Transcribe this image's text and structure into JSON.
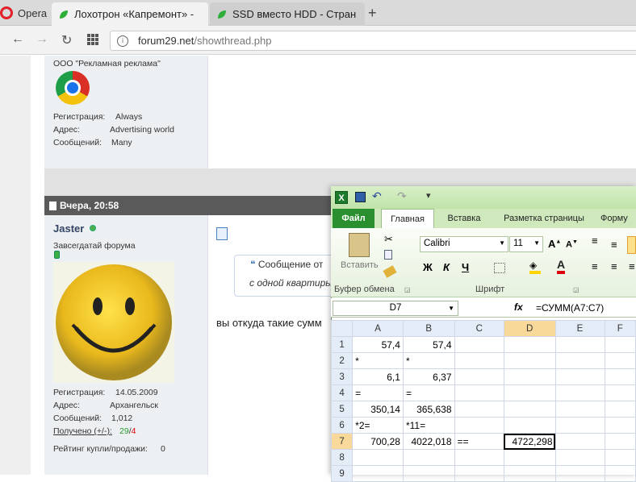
{
  "browser": {
    "brand": "Opera",
    "tabs": [
      {
        "title": "Лохотрон «Капремонт» -"
      },
      {
        "title": "SSD вместо HDD - Стран"
      }
    ],
    "url": {
      "host": "forum29.net",
      "path": "/showthread.php"
    }
  },
  "post1": {
    "company": "ООО \"Рекламная реклама\"",
    "reg_label": "Регистрация:",
    "reg_value": "Always",
    "addr_label": "Адрес:",
    "addr_value": "Advertising world",
    "msg_label": "Сообщений:",
    "msg_value": "Many"
  },
  "post2": {
    "header": "Вчера, 20:58",
    "username": "Jaster",
    "rank": "Завсегдатай форума",
    "reg_label": "Регистрация:",
    "reg_value": "14.05.2009",
    "addr_label": "Адрес:",
    "addr_value": "Архангельск",
    "msg_label": "Сообщений:",
    "msg_value": "1,012",
    "received_label": "Получено (+/-):",
    "received_plus": "29",
    "received_sep": "/",
    "received_minus": "4",
    "rating_label": "Рейтинг купли/продажи:",
    "rating_value": "0",
    "quote_title": "Сообщение от",
    "quote_text": "с одной квартиры",
    "body_text": "вы откуда такие сумм"
  },
  "excel": {
    "tabs": {
      "file": "Файл",
      "home": "Главная",
      "insert": "Вставка",
      "layout": "Разметка страницы",
      "formulas": "Форму"
    },
    "paste": "Вставить",
    "font": "Calibri",
    "size": "11",
    "groups": {
      "clipboard": "Буфер обмена",
      "font": "Шрифт"
    },
    "bold": "Ж",
    "italic": "К",
    "underline": "Ч",
    "namebox": "D7",
    "fx": "fx",
    "formula": "=СУММ(A7:C7)",
    "columns": [
      "A",
      "B",
      "C",
      "D",
      "E",
      "F"
    ],
    "rows": [
      {
        "n": "1",
        "A": "57,4",
        "B": "57,4",
        "C": "",
        "D": ""
      },
      {
        "n": "2",
        "A": "*",
        "B": "*",
        "C": "",
        "D": ""
      },
      {
        "n": "3",
        "A": "6,1",
        "B": "6,37",
        "C": "",
        "D": ""
      },
      {
        "n": "4",
        "A": "=",
        "B": "=",
        "C": "",
        "D": ""
      },
      {
        "n": "5",
        "A": "350,14",
        "B": "365,638",
        "C": "",
        "D": ""
      },
      {
        "n": "6",
        "A": "*2=",
        "B": "*11=",
        "C": "",
        "D": ""
      },
      {
        "n": "7",
        "A": "700,28",
        "B": "4022,018",
        "C": "==",
        "D": "4722,298"
      },
      {
        "n": "8",
        "A": "",
        "B": "",
        "C": "",
        "D": ""
      },
      {
        "n": "9",
        "A": "",
        "B": "",
        "C": "",
        "D": ""
      }
    ]
  }
}
